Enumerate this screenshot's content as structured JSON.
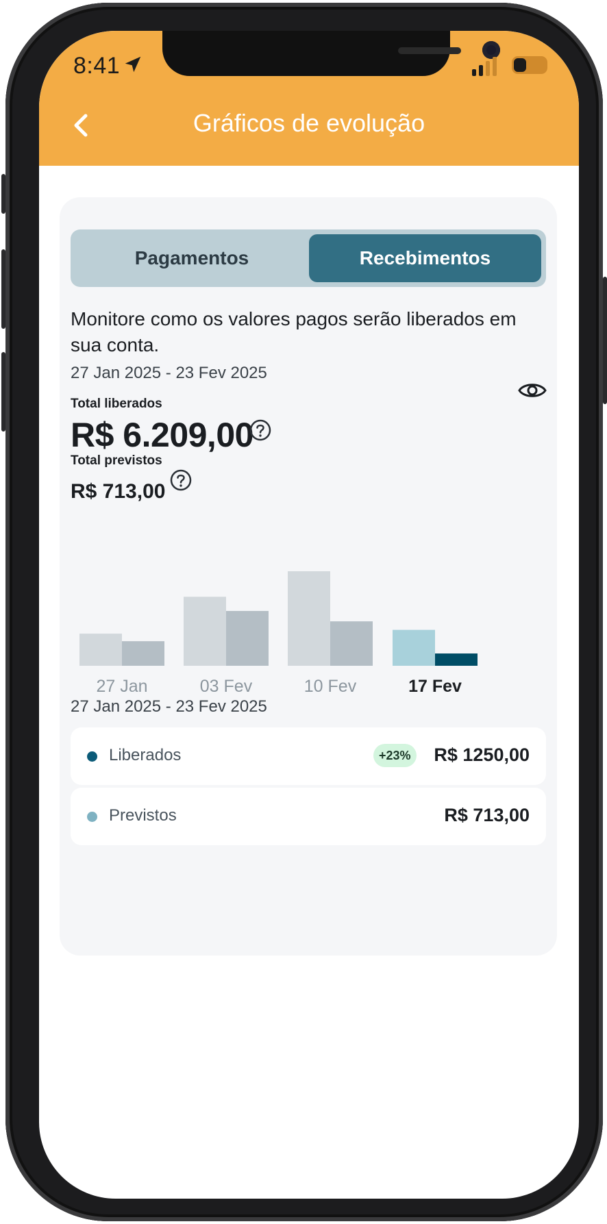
{
  "status_bar": {
    "time": "8:41"
  },
  "header": {
    "title": "Gráficos de evolução"
  },
  "tabs": [
    {
      "label": "Pagamentos",
      "active": false
    },
    {
      "label": "Recebimentos",
      "active": true
    }
  ],
  "description": "Monitore como os valores pagos serão liberados em sua conta.",
  "period": {
    "range": "27 Jan 2025 - 23 Fev 2025"
  },
  "totals": {
    "liberados_label": "Total liberados",
    "liberados_value": "R$ 6.209,00",
    "previstos_label": "Total previstos",
    "previstos_value": "R$ 713,00"
  },
  "chart_data": {
    "type": "bar",
    "categories": [
      "27 Jan",
      "03 Fev",
      "10 Fev",
      "17 Fev"
    ],
    "selected_category": "17 Fev",
    "series": [
      {
        "values": [
          0.34,
          0.73,
          1.0,
          0.38
        ]
      },
      {
        "values": [
          0.26,
          0.58,
          0.47,
          0.13
        ]
      }
    ],
    "colors": {
      "series_a": "#d2d8dc",
      "series_b": "#b4bec5",
      "selected_a": "#a8d1db",
      "selected_b": "#004d66"
    }
  },
  "breakdown": {
    "range": "27 Jan 2025 - 23 Fev 2025",
    "items": [
      {
        "label": "Liberados",
        "badge": "+23%",
        "value": "R$ 1250,00",
        "dot_color": "#0b5b78"
      },
      {
        "label": "Previstos",
        "value": "R$ 713,00",
        "dot_color": "#7fb2c2"
      }
    ]
  }
}
